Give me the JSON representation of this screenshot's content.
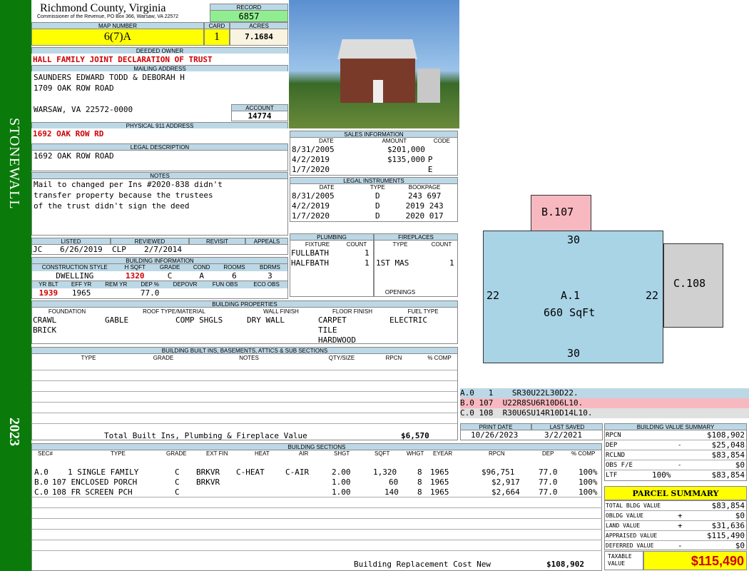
{
  "district": "STONEWALL",
  "year": "2023",
  "county": "Richmond County, Virginia",
  "commissioner": "Commissioner of the Revenue, PO Box 366, Warsaw, VA 22572",
  "record_label": "RECORD",
  "record": "6857",
  "map_label": "MAP NUMBER",
  "map_number": "6(7)A",
  "card_label": "CARD",
  "card": "1",
  "acres_label": "ACRES",
  "acres": "7.1684",
  "owner_label": "DEEDED OWNER",
  "owner": "HALL FAMILY JOINT DECLARATION OF TRUST",
  "mailing_label": "MAILING ADDRESS",
  "mail1": "SAUNDERS EDWARD TODD & DEBORAH H",
  "mail2": "1709 OAK ROW ROAD",
  "mail3": "WARSAW, VA 22572-0000",
  "account_label": "ACCOUNT",
  "account": "14774",
  "phys_label": "PHYSICAL 911 ADDRESS",
  "phys": "1692 OAK ROW RD",
  "legal_label": "LEGAL DESCRIPTION",
  "legal": "1692 OAK ROW ROAD",
  "notes_label": "NOTES",
  "notes": [
    "Mail to changed per Ins #2020-838 didn't",
    "transfer property because the trustees",
    "of the trust didn't sign the deed"
  ],
  "listed_label": "LISTED",
  "reviewed_label": "REVIEWED",
  "revisit_label": "REVISIT",
  "appeals_label": "APPEALS",
  "listed_by": "JC",
  "listed_date": "6/26/2019",
  "reviewed_by": "CLP",
  "reviewed_date": "2/7/2014",
  "bldg_info_label": "BUILDING INFORMATION",
  "bi_headers": [
    "CONSTRUCTION STYLE",
    "H SQFT",
    "GRADE",
    "COND",
    "ROOMS",
    "BDRMS"
  ],
  "bi_values": [
    "DWELLING",
    "1320",
    "C",
    "A",
    "6",
    "3"
  ],
  "bi_headers2": [
    "YR BLT",
    "EFF YR",
    "REM YR",
    "DEP %",
    "DEPOVR",
    "FUN OBS",
    "ECO OBS"
  ],
  "bi_values2": [
    "1939",
    "1965",
    "",
    "77.0",
    "",
    "",
    ""
  ],
  "props_label": "BUILDING PROPERTIES",
  "props_headers": [
    "FOUNDATION",
    "ROOF TYPE/MATERIAL",
    "WALL FINISH",
    "FLOOR FINISH",
    "FUEL TYPE"
  ],
  "foundation": [
    "CRAWL",
    "BRICK"
  ],
  "roof_type": "GABLE",
  "roof_mat": "COMP SHGLS",
  "wall": "DRY WALL",
  "floor": [
    "CARPET",
    "TILE",
    "HARDWOOD"
  ],
  "fuel": "ELECTRIC",
  "builtins_label": "BUILDING BUILT INS, BASEMENTS, ATTICS & SUB SECTIONS",
  "builtins_headers": [
    "TYPE",
    "GRADE",
    "NOTES",
    "QTY/SIZE",
    "RPCN",
    "% COMP"
  ],
  "total_builtins_label": "Total Built Ins, Plumbing & Fireplace Value",
  "total_builtins": "$6,570",
  "sales_label": "SALES INFORMATION",
  "sales_headers": [
    "DATE",
    "AMOUNT",
    "CODE"
  ],
  "sales": [
    [
      "8/31/2005",
      "$201,000",
      ""
    ],
    [
      "4/2/2019",
      "$135,000",
      "P"
    ],
    [
      "1/7/2020",
      "",
      "E"
    ]
  ],
  "legalinst_label": "LEGAL INSTRUMENTS",
  "li_headers": [
    "DATE",
    "TYPE",
    "BOOKPAGE"
  ],
  "instruments": [
    [
      "8/31/2005",
      "D",
      "243 697"
    ],
    [
      "4/2/2019",
      "D",
      "2019 243"
    ],
    [
      "1/7/2020",
      "D",
      "2020 017"
    ]
  ],
  "plumbing_label": "PLUMBING",
  "plumb_headers": [
    "FIXTURE",
    "COUNT"
  ],
  "plumbing": [
    [
      "FULLBATH",
      "1"
    ],
    [
      "HALFBATH",
      "1"
    ]
  ],
  "fireplace_label": "FIREPLACES",
  "fp_headers": [
    "TYPE",
    "COUNT"
  ],
  "fireplaces": [
    [
      "1ST MAS",
      "1"
    ]
  ],
  "openings_label": "OPENINGS",
  "sketch": {
    "b_label": "B.107",
    "a_label": "A.1",
    "a_area": "660 SqFt",
    "c_label": "C.108",
    "top": "30",
    "bottom": "30",
    "left": "22",
    "right": "22"
  },
  "sketch_rows": [
    [
      "A.0",
      "1",
      "SR30U22L30D22."
    ],
    [
      "B.0",
      "107",
      "U22R8SU6R10D6L10."
    ],
    [
      "C.0",
      "108",
      "R30U6SU14R10D14L10."
    ]
  ],
  "print_label": "PRINT DATE",
  "print_date": "10/26/2023",
  "saved_label": "LAST SAVED",
  "saved_date": "3/2/2021",
  "sections_label": "BUILDING SECTIONS",
  "sec_headers": [
    "SEC#",
    "TYPE",
    "GRADE",
    "EXT FIN",
    "HEAT",
    "AIR",
    "SHGT",
    "SQFT",
    "WHGT",
    "EYEAR",
    "RPCN",
    "DEP",
    "% COMP"
  ],
  "sections": [
    [
      "A.0",
      "1 SINGLE FAMILY",
      "C",
      "BRKVR",
      "C-HEAT",
      "C-AIR",
      "2.00",
      "1,320",
      "8",
      "1965",
      "$96,751",
      "77.0",
      "100%"
    ],
    [
      "B.0",
      "107 ENCLOSED PORCH",
      "C",
      "BRKVR",
      "",
      "",
      "1.00",
      "60",
      "8",
      "1965",
      "$2,917",
      "77.0",
      "100%"
    ],
    [
      "C.0",
      "108 FR SCREEN PCH",
      "C",
      "",
      "",
      "",
      "1.00",
      "140",
      "8",
      "1965",
      "$2,664",
      "77.0",
      "100%"
    ]
  ],
  "brcn_label": "Building Replacement Cost New",
  "brcn": "$108,902",
  "bvs_label": "BUILDING VALUE SUMMARY",
  "bvs": [
    [
      "RPCN",
      "",
      "$108,902"
    ],
    [
      "DEP",
      "-",
      "$25,048"
    ],
    [
      "RCLND",
      "",
      "$83,854"
    ],
    [
      "OBS F/E",
      "-",
      "$0"
    ],
    [
      "LTF",
      "100%",
      "$83,854"
    ]
  ],
  "parcel_label": "PARCEL SUMMARY",
  "parcel": [
    [
      "TOTAL BLDG VALUE",
      "",
      "$83,854"
    ],
    [
      "OBLDG VALUE",
      "+",
      "$0"
    ],
    [
      "LAND VALUE",
      "+",
      "$31,636"
    ],
    [
      "APPRAISED VALUE",
      "",
      "$115,490"
    ],
    [
      "DEFERRED VALUE",
      "-",
      "$0"
    ]
  ],
  "taxable_label": "TAXABLE VALUE",
  "taxable": "$115,490",
  "colors": {
    "green": "#0a7a0a",
    "header_blue": "#bcd8e6",
    "yellow": "#ffff00",
    "record_green": "#90ee90",
    "sketch_blue": "#a8d4e6",
    "sketch_pink": "#f8b8c0",
    "sketch_gray": "#d0d0d0"
  }
}
